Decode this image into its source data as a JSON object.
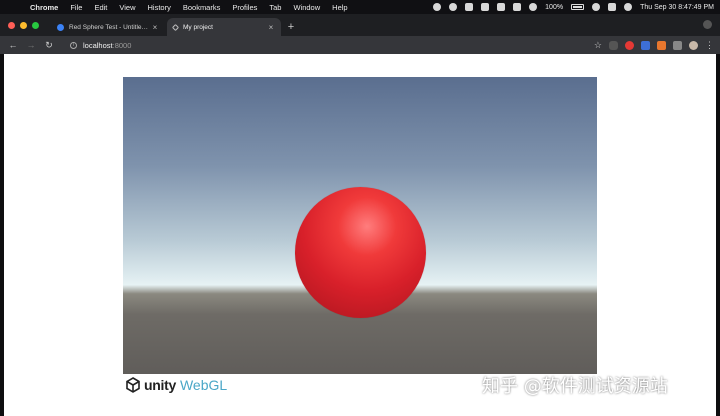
{
  "menubar": {
    "app": "Chrome",
    "items": [
      "File",
      "Edit",
      "View",
      "History",
      "Bookmarks",
      "Profiles",
      "Tab",
      "Window",
      "Help"
    ],
    "battery": "100%",
    "clock": "Thu Sep 30  8:47:49 PM"
  },
  "tabs": [
    {
      "title": "Red Sphere Test - Untitled Cre",
      "active": false
    },
    {
      "title": "My project",
      "active": true
    }
  ],
  "toolbar": {
    "url_host": "localhost",
    "url_port": ":8000"
  },
  "webgl": {
    "brand": "unity",
    "platform": "WebGL"
  },
  "watermark": "知乎 @软件测试资源站",
  "colors": {
    "sphere": "#e8242c",
    "webgl_text": "#4aa7c7"
  }
}
